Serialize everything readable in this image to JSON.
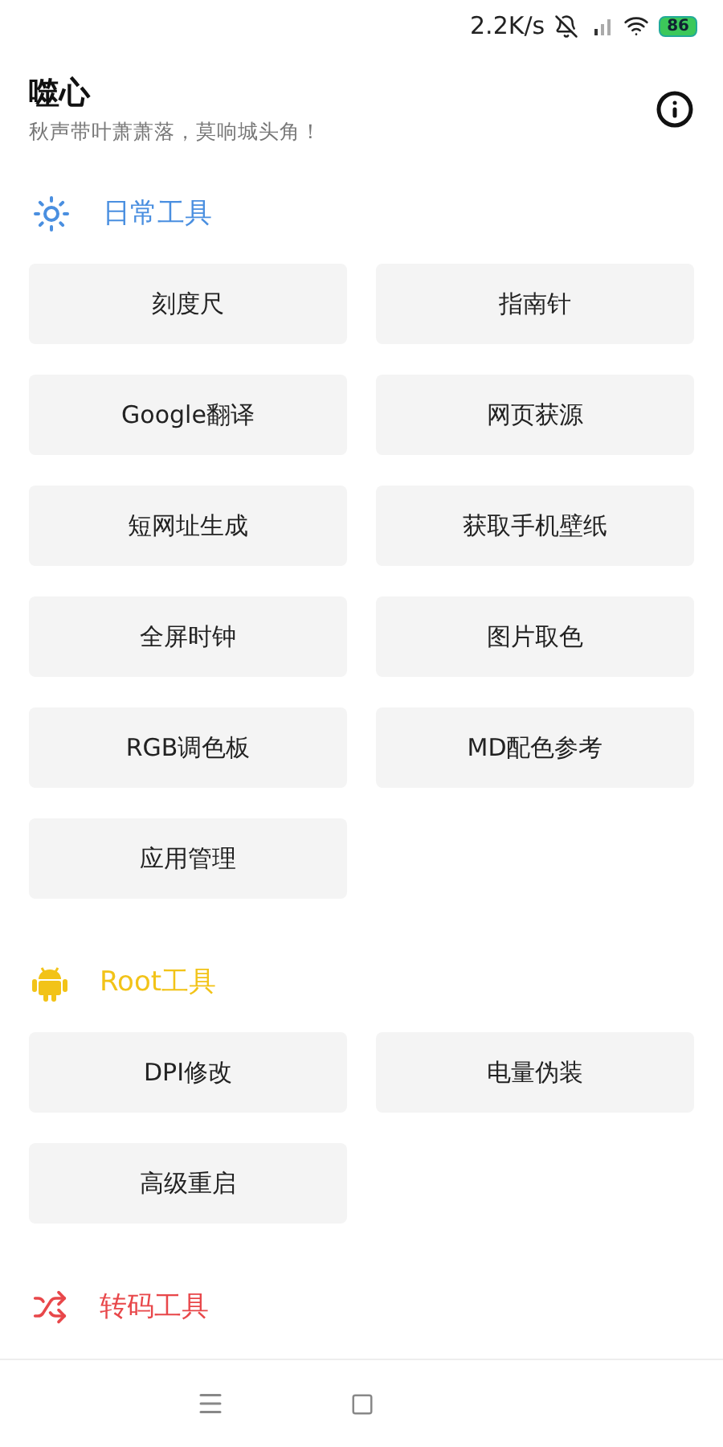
{
  "status_bar": {
    "speed": "2.2K/s",
    "battery": "86"
  },
  "header": {
    "title": "噬心",
    "subtitle": "秋声带叶萧萧落，莫响城头角！"
  },
  "sections": [
    {
      "title": "日常工具",
      "color": "#4a8fe0",
      "tools": [
        "刻度尺",
        "指南针",
        "Google翻译",
        "网页获源",
        "短网址生成",
        "获取手机壁纸",
        "全屏时钟",
        "图片取色",
        "RGB调色板",
        "MD配色参考",
        "应用管理"
      ]
    },
    {
      "title": "Root工具",
      "color": "#f2c318",
      "tools": [
        "DPI修改",
        "电量伪装",
        "高级重启"
      ]
    },
    {
      "title": "转码工具",
      "color": "#e8474a"
    }
  ]
}
